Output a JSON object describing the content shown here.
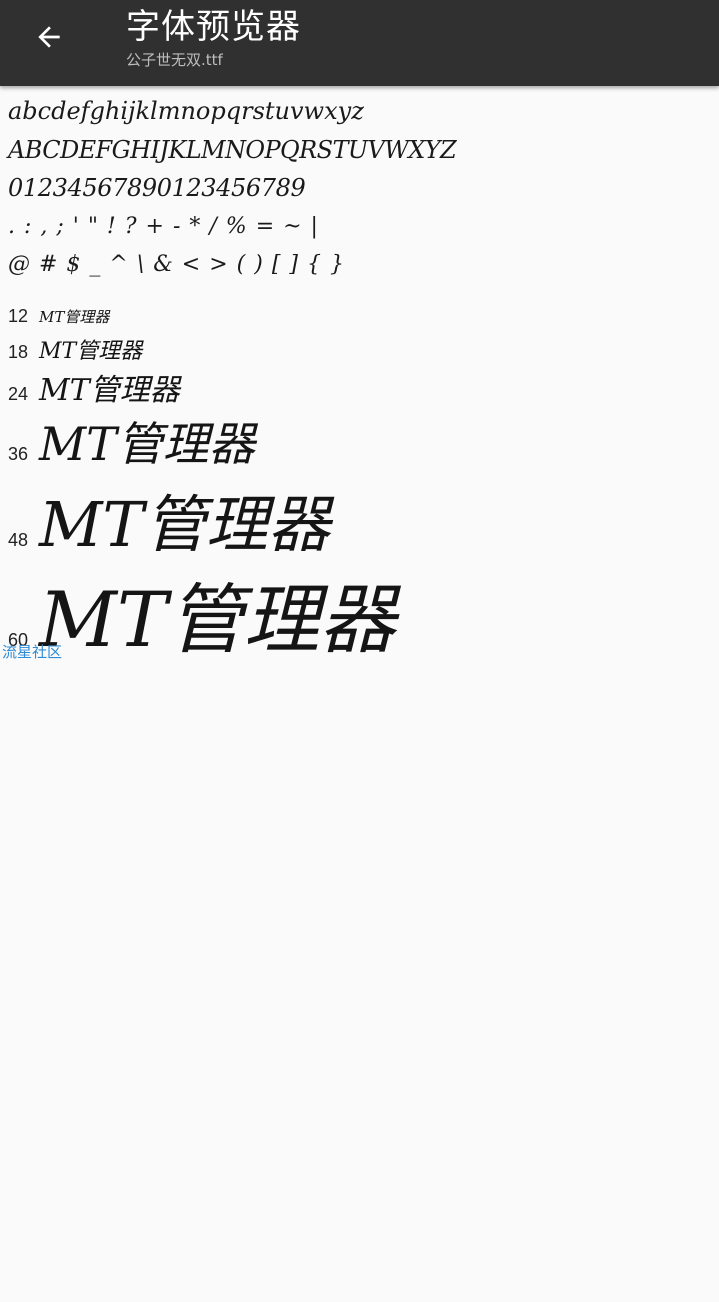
{
  "toolbar": {
    "title": "字体预览器",
    "subtitle": "公子世无双.ttf",
    "back_icon": "arrow-left-icon"
  },
  "preview": {
    "lowercase": "abcdefghijklmnopqrstuvwxyz",
    "uppercase": "ABCDEFGHIJKLMNOPQRSTUVWXYZ",
    "digits": "01234567890123456789",
    "punct1": ". : , ; ' \" ! ? + - * / % = ~ |",
    "punct2": "@ # $ _ ^ \\ & < > ( ) [ ] { }"
  },
  "sizes": [
    {
      "size": "12",
      "sample": "MT管理器"
    },
    {
      "size": "18",
      "sample": "MT管理器"
    },
    {
      "size": "24",
      "sample": "MT管理器"
    },
    {
      "size": "36",
      "sample": "MT管理器"
    },
    {
      "size": "48",
      "sample": "MT管理器"
    },
    {
      "size": "60",
      "sample": "MT管理器"
    }
  ],
  "watermark": "流星社区"
}
